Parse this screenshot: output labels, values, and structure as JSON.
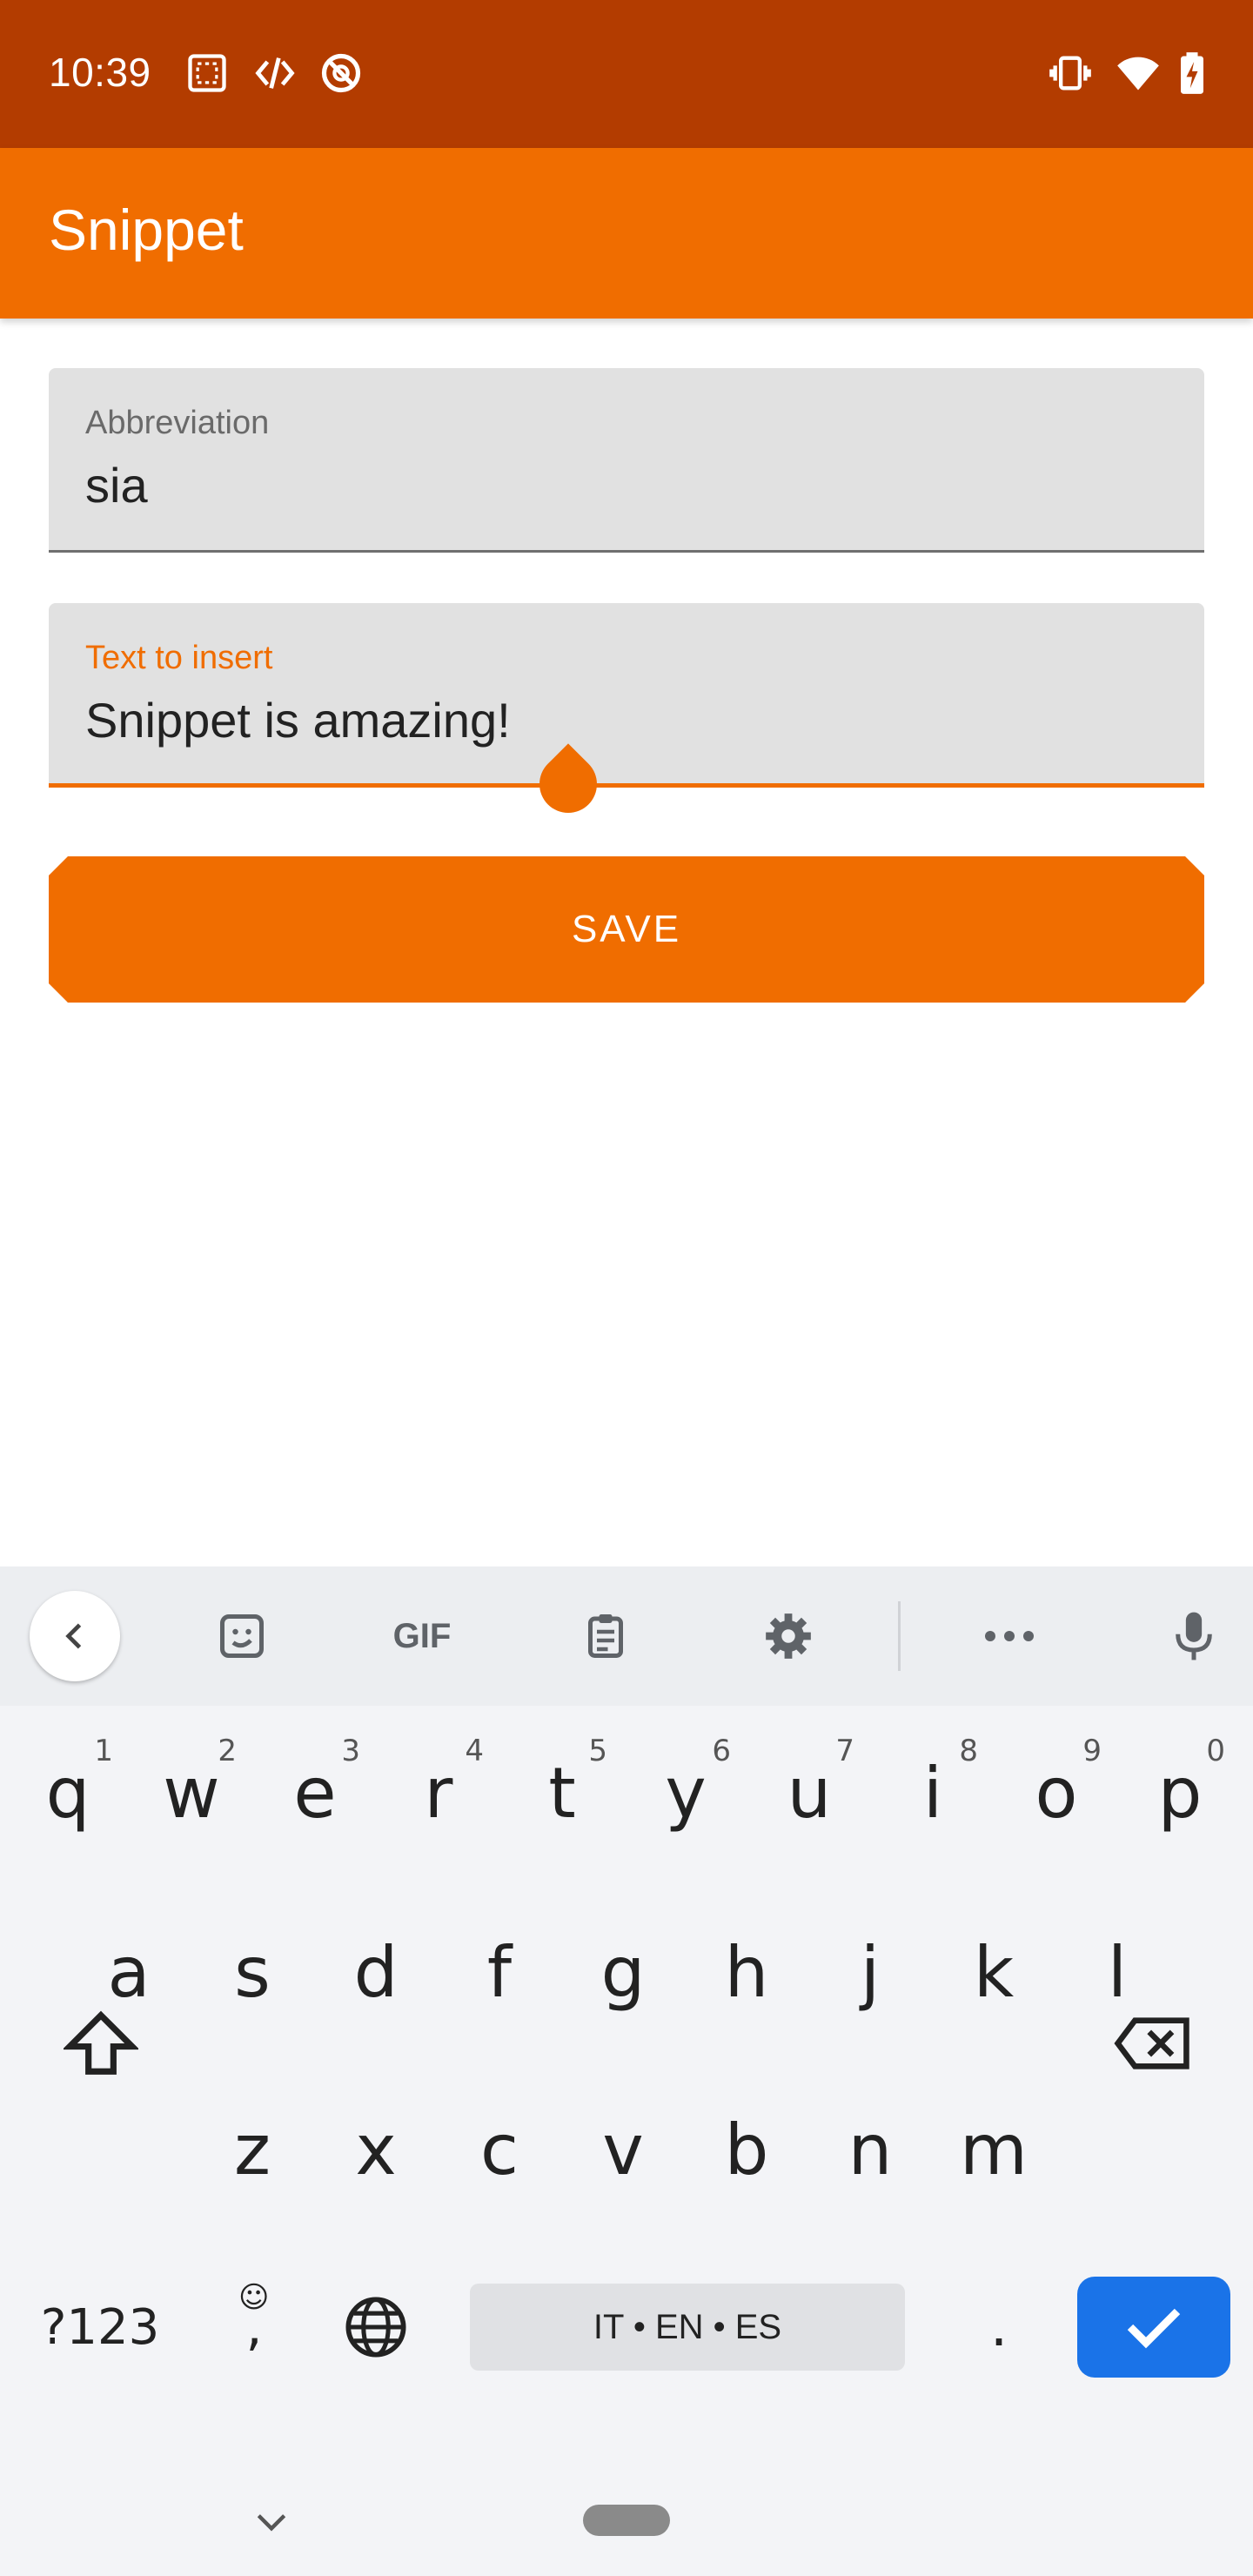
{
  "status_bar": {
    "time": "10:39",
    "left_icons": [
      "screenshot-icon",
      "code-icon",
      "no-disturb-icon"
    ],
    "right_icons": [
      "vibrate-icon",
      "wifi-icon",
      "battery-charging-icon"
    ],
    "background": "#b33c00"
  },
  "app_bar": {
    "title": "Snippet",
    "background": "#f06d00"
  },
  "form": {
    "abbreviation": {
      "label": "Abbreviation",
      "value": "sia"
    },
    "text_to_insert": {
      "label": "Text to insert",
      "value": "Snippet is amazing!"
    },
    "save_label": "SAVE",
    "accent": "#f06d00"
  },
  "keyboard": {
    "toolbar_icons": [
      "back-icon",
      "sticker-icon",
      "gif-icon",
      "clipboard-icon",
      "settings-icon",
      "more-icon",
      "mic-icon"
    ],
    "gif_label": "GIF",
    "row1": [
      {
        "k": "q",
        "n": "1"
      },
      {
        "k": "w",
        "n": "2"
      },
      {
        "k": "e",
        "n": "3"
      },
      {
        "k": "r",
        "n": "4"
      },
      {
        "k": "t",
        "n": "5"
      },
      {
        "k": "y",
        "n": "6"
      },
      {
        "k": "u",
        "n": "7"
      },
      {
        "k": "i",
        "n": "8"
      },
      {
        "k": "o",
        "n": "9"
      },
      {
        "k": "p",
        "n": "0"
      }
    ],
    "row2": [
      "a",
      "s",
      "d",
      "f",
      "g",
      "h",
      "j",
      "k",
      "l"
    ],
    "row3": [
      "z",
      "x",
      "c",
      "v",
      "b",
      "n",
      "m"
    ],
    "symbols_label": "?123",
    "comma_label": ",",
    "space_label": "IT • EN • ES",
    "period_label": ".",
    "enter_color": "#1a73e8"
  }
}
